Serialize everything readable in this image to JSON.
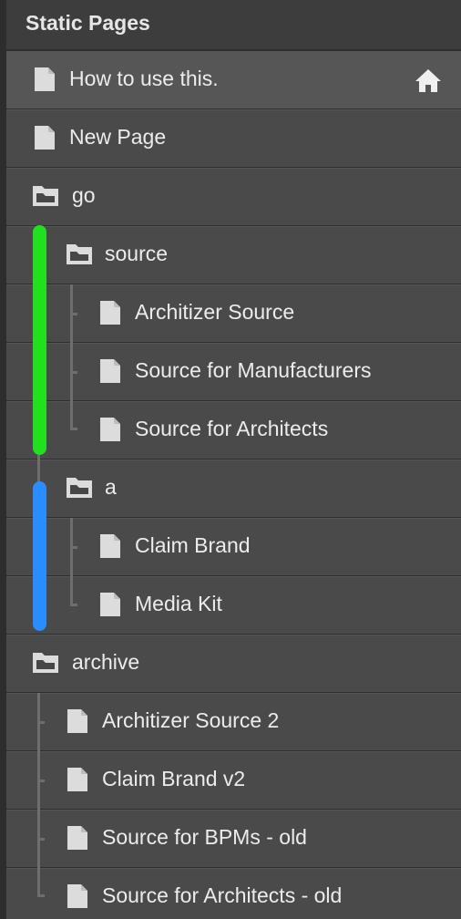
{
  "header": {
    "title": "Static Pages"
  },
  "items": [
    {
      "label": "How to use this.",
      "kind": "page",
      "icon": "document-icon",
      "home_icon": "home-icon"
    },
    {
      "label": "New Page",
      "kind": "page",
      "icon": "document-icon"
    },
    {
      "label": "go",
      "kind": "folder",
      "icon": "folder-icon"
    },
    {
      "label": "source",
      "kind": "folder",
      "icon": "folder-icon"
    },
    {
      "label": "Architizer Source",
      "kind": "page",
      "icon": "document-icon"
    },
    {
      "label": "Source for Manufacturers",
      "kind": "page",
      "icon": "document-icon"
    },
    {
      "label": "Source for Architects",
      "kind": "page",
      "icon": "document-icon"
    },
    {
      "label": "a",
      "kind": "folder",
      "icon": "folder-icon"
    },
    {
      "label": "Claim Brand",
      "kind": "page",
      "icon": "document-icon"
    },
    {
      "label": "Media Kit",
      "kind": "page",
      "icon": "document-icon"
    },
    {
      "label": "archive",
      "kind": "folder",
      "icon": "folder-icon"
    },
    {
      "label": "Architizer Source 2",
      "kind": "page",
      "icon": "document-icon"
    },
    {
      "label": "Claim Brand v2",
      "kind": "page",
      "icon": "document-icon"
    },
    {
      "label": "Source for BPMs - old",
      "kind": "page",
      "icon": "document-icon"
    },
    {
      "label": "Source for Architects - old",
      "kind": "page",
      "icon": "document-icon"
    }
  ],
  "group_markers": [
    {
      "group": "source",
      "color": "#22e01f"
    },
    {
      "group": "a",
      "color": "#2a8dff"
    }
  ],
  "colors": {
    "panel": "#474747",
    "header": "#3d3d3d",
    "text": "#ececec",
    "icon": "#dcdcdc",
    "tree_line": "#6e6e6e"
  }
}
